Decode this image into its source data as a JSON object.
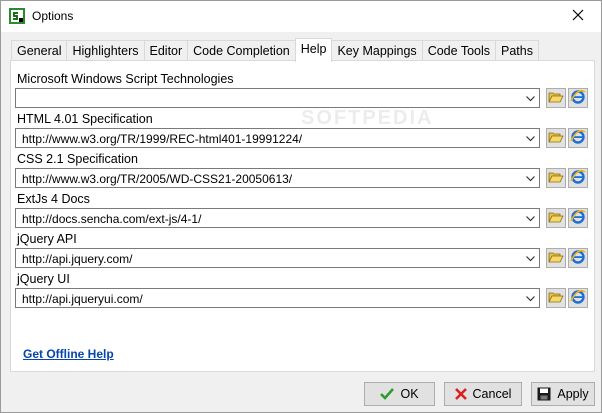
{
  "window": {
    "title": "Options",
    "app_icon": "app-logo-icon",
    "close_icon": "close-icon"
  },
  "tabs": [
    {
      "label": "General"
    },
    {
      "label": "Highlighters"
    },
    {
      "label": "Editor"
    },
    {
      "label": "Code Completion"
    },
    {
      "label": "Help",
      "active": true
    },
    {
      "label": "Key Mappings"
    },
    {
      "label": "Code Tools"
    },
    {
      "label": "Paths"
    }
  ],
  "help": {
    "entries": [
      {
        "label": "Microsoft Windows Script Technologies",
        "value": ""
      },
      {
        "label": "HTML 4.01 Specification",
        "value": "http://www.w3.org/TR/1999/REC-html401-19991224/"
      },
      {
        "label": "CSS 2.1 Specification",
        "value": "http://www.w3.org/TR/2005/WD-CSS21-20050613/"
      },
      {
        "label": "ExtJs 4 Docs",
        "value": "http://docs.sencha.com/ext-js/4-1/"
      },
      {
        "label": "jQuery API",
        "value": "http://api.jquery.com/"
      },
      {
        "label": "jQuery UI",
        "value": "http://api.jqueryui.com/"
      }
    ],
    "offline_link": "Get Offline Help"
  },
  "watermark": "SOFTPEDIA",
  "buttons": {
    "ok": "OK",
    "cancel": "Cancel",
    "apply": "Apply"
  }
}
